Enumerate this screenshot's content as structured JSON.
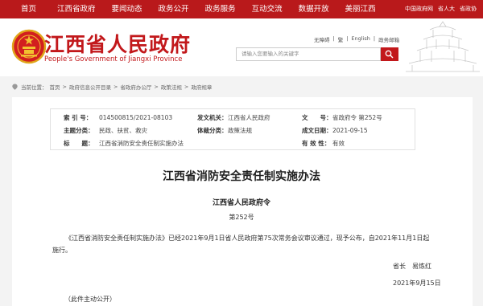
{
  "topnav": {
    "items": [
      "首页",
      "江西省政府",
      "要闻动态",
      "政务公开",
      "政务服务",
      "互动交流",
      "数据开放",
      "美丽江西"
    ],
    "right": [
      "中国政府网",
      "省人大",
      "省政协"
    ]
  },
  "header": {
    "title": "江西省人民政府",
    "subtitle": "People's Government of Jiangxi Province",
    "util": [
      "无障碍",
      "|",
      "繁",
      "|",
      "English",
      "|",
      "政务邮箱"
    ],
    "search_placeholder": "请输入您要输入的关键字"
  },
  "breadcrumb": [
    "当前位置：",
    "首页",
    ">",
    "政府信息公开目录",
    ">",
    "省政府办公厅",
    ">",
    "政策法规",
    ">",
    "政府规章"
  ],
  "meta": {
    "index_label": "索 引 号：",
    "index_value": "014500815/2021-08103",
    "issuer_label": "发文机关：",
    "issuer_value": "江西省人民政府",
    "docno_label": "文　　号：",
    "docno_value": "省政府令 第252号",
    "topic_label": "主题分类：",
    "topic_value": "民政、扶贫、救灾",
    "category_label": "体裁分类：",
    "category_value": "政策法规",
    "date_label": "成文日期：",
    "date_value": "2021-09-15",
    "title_label": "标　　题：",
    "title_value": "江西省消防安全责任制实施办法",
    "validity_label": "有 效 性：",
    "validity_value": "有效"
  },
  "document": {
    "title": "江西省消防安全责任制实施办法",
    "issuer": "江西省人民政府令",
    "number": "第252号",
    "body": "《江西省消防安全责任制实施办法》已经2021年9月1日省人民政府第75次常务会议审议通过，现予公布，自2021年11月1日起施行。",
    "sign_role": "省长",
    "sign_name": "易炼红",
    "sign_date": "2021年9月15日",
    "note": "（此件主动公开）"
  },
  "colors": {
    "brand_red": "#b9191b",
    "page_bg": "#f3f3f3"
  }
}
